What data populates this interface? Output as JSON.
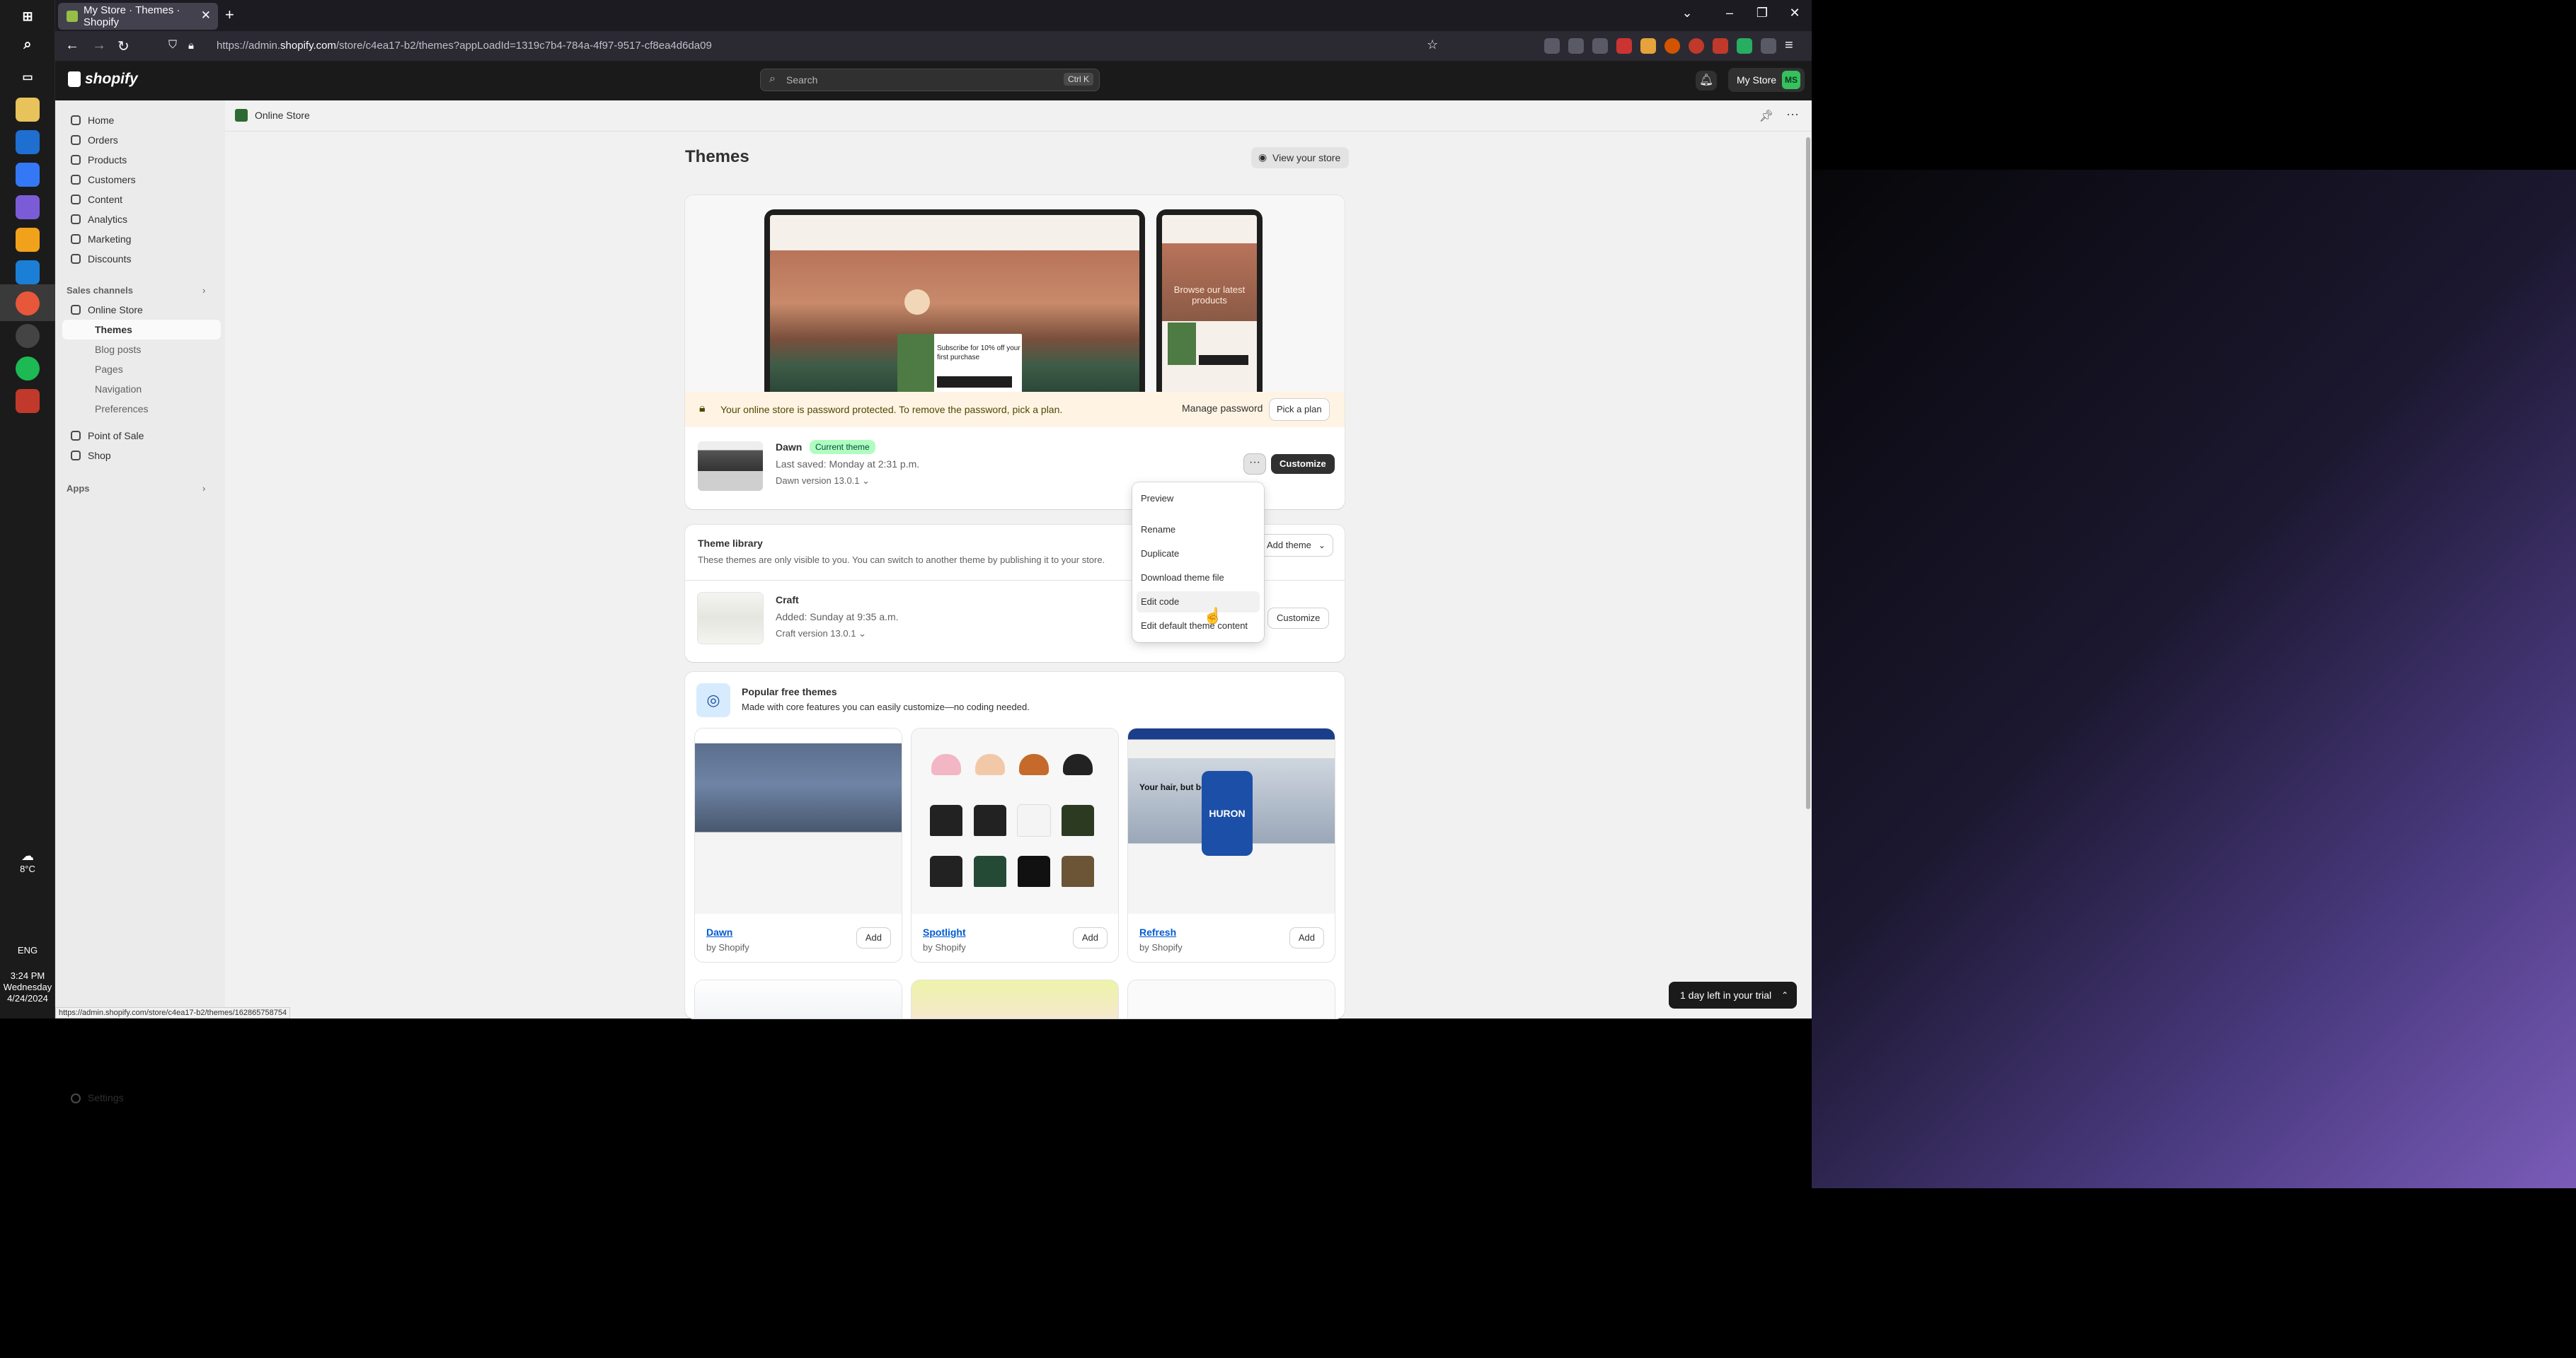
{
  "browser": {
    "tab_title": "My Store · Themes · Shopify",
    "url_prefix": "https://admin.",
    "url_domain": "shopify.com",
    "url_rest": "/store/c4ea17-b2/themes?appLoadId=1319c7b4-784a-4f97-9517-cf8ea4d6da09"
  },
  "header": {
    "logo": "shopify",
    "search_placeholder": "Search",
    "search_shortcut": "Ctrl K",
    "store_name": "My Store",
    "avatar_initials": "MS"
  },
  "sidebar": {
    "items": [
      {
        "label": "Home"
      },
      {
        "label": "Orders"
      },
      {
        "label": "Products"
      },
      {
        "label": "Customers"
      },
      {
        "label": "Content"
      },
      {
        "label": "Analytics"
      },
      {
        "label": "Marketing"
      },
      {
        "label": "Discounts"
      }
    ],
    "sales_channels_label": "Sales channels",
    "online_store": "Online Store",
    "sub_items": [
      {
        "label": "Themes"
      },
      {
        "label": "Blog posts"
      },
      {
        "label": "Pages"
      },
      {
        "label": "Navigation"
      },
      {
        "label": "Preferences"
      }
    ],
    "point_of_sale": "Point of Sale",
    "shop": "Shop",
    "apps_label": "Apps",
    "settings": "Settings"
  },
  "page": {
    "breadcrumb": "Online Store",
    "title": "Themes",
    "view_store": "View your store"
  },
  "preview": {
    "popup_text": "Subscribe for 10% off your first purchase",
    "phone_heading": "Browse our latest products"
  },
  "banner": {
    "message": "Your online store is password protected. To remove the password, pick a plan.",
    "manage_password": "Manage password",
    "pick_plan": "Pick a plan"
  },
  "current_theme": {
    "name": "Dawn",
    "badge": "Current theme",
    "last_saved": "Last saved: Monday at 2:31 p.m.",
    "version": "Dawn version 13.0.1",
    "more": "···",
    "customize": "Customize"
  },
  "actions_menu": {
    "items": [
      {
        "label": "Preview"
      },
      {
        "label": "Rename"
      },
      {
        "label": "Duplicate"
      },
      {
        "label": "Download theme file"
      },
      {
        "label": "Edit code"
      },
      {
        "label": "Edit default theme content"
      }
    ]
  },
  "library": {
    "title": "Theme library",
    "description": "These themes are only visible to you. You can switch to another theme by publishing it to your store.",
    "add_theme": "Add theme",
    "theme": {
      "name": "Craft",
      "added": "Added: Sunday at 9:35 a.m.",
      "version": "Craft version 13.0.1",
      "customize": "Customize"
    }
  },
  "popular": {
    "title": "Popular free themes",
    "description": "Made with core features you can easily customize—no coding needed.",
    "themes": [
      {
        "name": "Dawn",
        "by": "by Shopify",
        "add": "Add"
      },
      {
        "name": "Spotlight",
        "by": "by Shopify",
        "add": "Add"
      },
      {
        "name": "Refresh",
        "by": "by Shopify",
        "add": "Add"
      }
    ],
    "refresh_headline": "Your hair, but better.",
    "refresh_brand": "HURON"
  },
  "status_url": "https://admin.shopify.com/store/c4ea17-b2/themes/162865758754",
  "trial": "1 day left in your trial",
  "os": {
    "time": "3:24 PM",
    "day": "Wednesday",
    "date": "4/24/2024",
    "lang": "ENG",
    "temp": "8°C"
  }
}
